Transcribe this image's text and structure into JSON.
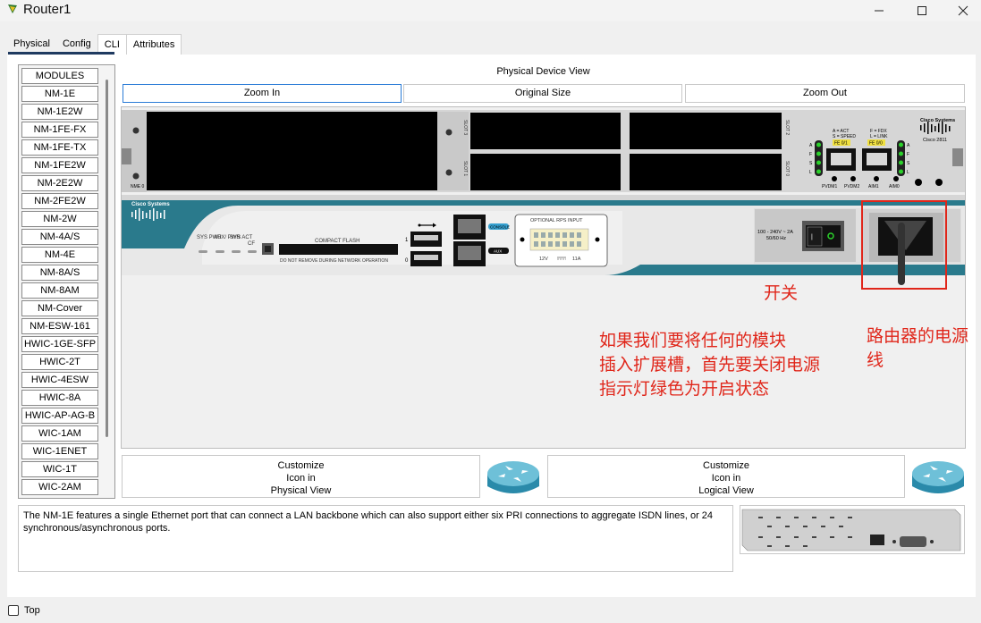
{
  "window": {
    "title": "Router1"
  },
  "tabs": [
    "Physical",
    "Config",
    "CLI",
    "Attributes"
  ],
  "modules": {
    "header": "MODULES",
    "items": [
      "NM-1E",
      "NM-1E2W",
      "NM-1FE-FX",
      "NM-1FE-TX",
      "NM-1FE2W",
      "NM-2E2W",
      "NM-2FE2W",
      "NM-2W",
      "NM-4A/S",
      "NM-4E",
      "NM-8A/S",
      "NM-8AM",
      "NM-Cover",
      "NM-ESW-161",
      "HWIC-1GE-SFP",
      "HWIC-2T",
      "HWIC-4ESW",
      "HWIC-8A",
      "HWIC-AP-AG-B",
      "WIC-1AM",
      "WIC-1ENET",
      "WIC-1T",
      "WIC-2AM"
    ]
  },
  "view": {
    "title": "Physical Device View",
    "zoom_in": "Zoom In",
    "original_size": "Original Size",
    "zoom_out": "Zoom Out"
  },
  "device": {
    "brand": "Cisco Systems",
    "model": "Cisco 2811",
    "slot_nme": "NME 0",
    "slot3": "SLOT 3",
    "slot1": "SLOT 1",
    "slot2": "SLOT 2",
    "slot0": "SLOT 0",
    "act_label": "A = ACT",
    "speed_label": "S = SPEED",
    "fdx_label": "F = FDX",
    "link_label": "L = LINK",
    "port_fe01": "FE 0/1",
    "port_fe00": "FE 0/0",
    "afsl": [
      "A",
      "F",
      "S",
      "L"
    ],
    "pvdm1": "PVDM1",
    "pvdm2": "PVDM2",
    "aim1": "AIM1",
    "aim0": "AIM0",
    "sys_pwr": "SYS PWR",
    "aux_pwr": "AUX/ PWR",
    "sys_act": "SYS ACT",
    "cf": "CF",
    "compact_flash": "COMPACT FLASH",
    "no_remove": "DO NOT REMOVE DURING NETWORK OPERATION",
    "usb1": "1",
    "usb0": "0",
    "console": "CONSOLE",
    "aux": "AUX",
    "rps": "OPTIONAL RPS INPUT",
    "rps_12v": "12V",
    "rps_11a": "11A",
    "power_rating": "100 - 240V ~ 2A",
    "power_hz": "50/60 Hz"
  },
  "annotations": {
    "switch_label": "开关",
    "power_cord_label": "路由器的电源\n线",
    "instruction_1": "如果我们要将任何的模块",
    "instruction_2": "插入扩展槽，首先要关闭电源",
    "instruction_3": "指示灯绿色为开启状态"
  },
  "customize": {
    "physical": [
      "Customize",
      "Icon in",
      "Physical View"
    ],
    "logical": [
      "Customize",
      "Icon in",
      "Logical View"
    ]
  },
  "description": "The NM-1E features a single Ethernet port that can connect a LAN backbone which can also support either six PRI connections to aggregate ISDN lines, or 24 synchronous/asynchronous ports.",
  "footer": {
    "top_label": "Top",
    "top_checked": false
  },
  "colors": {
    "accent": "#1f3a60",
    "annotation": "#e0261a",
    "device_teal": "#2a7a8c",
    "led_green": "#2bd12b",
    "focus_blue": "#2a7bd6"
  }
}
